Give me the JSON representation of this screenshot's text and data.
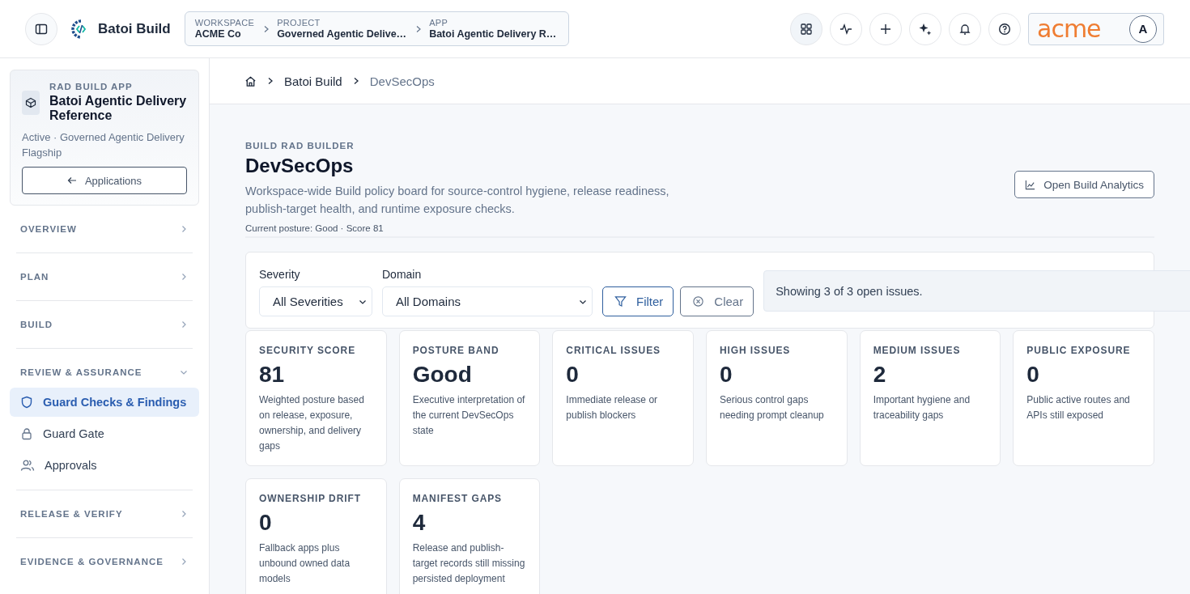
{
  "header": {
    "product": "Batoi Build",
    "context": [
      {
        "label": "WORKSPACE",
        "value": "ACME Co"
      },
      {
        "label": "PROJECT",
        "value": "Governed Agentic Delive…"
      },
      {
        "label": "APP",
        "value": "Batoi Agentic Delivery R…"
      }
    ],
    "logo_text": "acme",
    "avatar": "A"
  },
  "sidebar": {
    "app_card": {
      "eyebrow": "RAD BUILD APP",
      "title": "Batoi Agentic Delivery Reference",
      "subtitle": "Active · Governed Agentic Delivery Flagship",
      "back_button": "Applications"
    },
    "sections": [
      {
        "label": "OVERVIEW",
        "expanded": false
      },
      {
        "label": "PLAN",
        "expanded": false
      },
      {
        "label": "BUILD",
        "expanded": false
      },
      {
        "label": "REVIEW & ASSURANCE",
        "expanded": true,
        "items": [
          {
            "label": "Guard Checks & Findings",
            "kind": "shield",
            "selected": true
          },
          {
            "label": "Guard Gate",
            "kind": "lock",
            "selected": false
          },
          {
            "label": "Approvals",
            "kind": "people",
            "selected": false
          }
        ]
      },
      {
        "label": "RELEASE & VERIFY",
        "expanded": false
      },
      {
        "label": "EVIDENCE & GOVERNANCE",
        "expanded": false
      }
    ]
  },
  "breadcrumb": [
    "Batoi Build",
    "DevSecOps"
  ],
  "page": {
    "eyebrow": "BUILD RAD BUILDER",
    "title": "DevSecOps",
    "description": "Workspace-wide Build policy board for source-control hygiene, release readiness, publish-target health, and runtime exposure checks.",
    "posture": "Current posture: Good · Score 81",
    "action_button": "Open Build Analytics"
  },
  "filters": {
    "severity": {
      "label": "Severity",
      "value": "All Severities"
    },
    "domain": {
      "label": "Domain",
      "value": "All Domains"
    },
    "filter_button": "Filter",
    "clear_button": "Clear",
    "status": "Showing 3 of 3 open issues."
  },
  "metrics": [
    {
      "label": "SECURITY SCORE",
      "value": "81",
      "note": "Weighted posture based on release, exposure, ownership, and delivery gaps"
    },
    {
      "label": "POSTURE BAND",
      "value": "Good",
      "note": "Executive interpretation of the current DevSecOps state"
    },
    {
      "label": "CRITICAL ISSUES",
      "value": "0",
      "note": "Immediate release or publish blockers"
    },
    {
      "label": "HIGH ISSUES",
      "value": "0",
      "note": "Serious control gaps needing prompt cleanup"
    },
    {
      "label": "MEDIUM ISSUES",
      "value": "2",
      "note": "Important hygiene and traceability gaps"
    },
    {
      "label": "PUBLIC EXPOSURE",
      "value": "0",
      "note": "Public active routes and APIs still exposed"
    },
    {
      "label": "OWNERSHIP DRIFT",
      "value": "0",
      "note": "Fallback apps plus unbound owned data models"
    },
    {
      "label": "MANIFEST GAPS",
      "value": "4",
      "note": "Release and publish-target records still missing persisted deployment"
    }
  ]
}
